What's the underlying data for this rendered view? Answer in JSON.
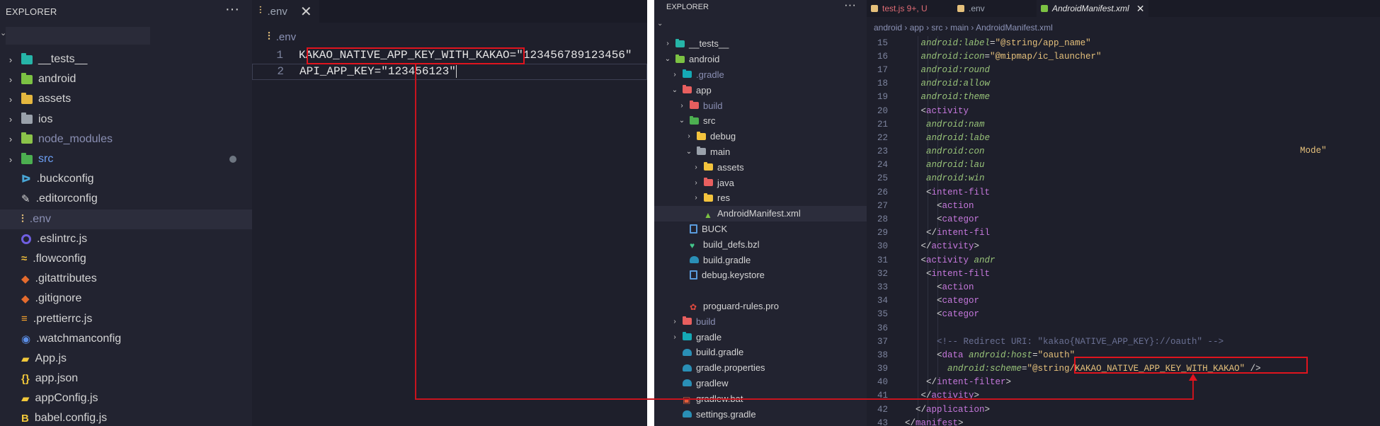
{
  "left": {
    "explorer": {
      "title": "EXPLORER",
      "more": "···",
      "items": [
        {
          "label": "__tests__",
          "icon": "folder-tests-icon",
          "chevron": ">"
        },
        {
          "label": "android",
          "icon": "folder-android-icon",
          "chevron": ">"
        },
        {
          "label": "assets",
          "icon": "folder-assets-icon",
          "chevron": ">"
        },
        {
          "label": "ios",
          "icon": "folder-ios-icon",
          "chevron": ">"
        },
        {
          "label": "node_modules",
          "icon": "folder-node-icon",
          "chevron": ">"
        },
        {
          "label": "src",
          "icon": "folder-src-icon",
          "chevron": ">"
        },
        {
          "label": ".buckconfig",
          "icon": "buck-icon"
        },
        {
          "label": ".editorconfig",
          "icon": "editorconfig-icon"
        },
        {
          "label": ".env",
          "icon": "env-icon"
        },
        {
          "label": ".eslintrc.js",
          "icon": "eslint-icon"
        },
        {
          "label": ".flowconfig",
          "icon": "flow-icon"
        },
        {
          "label": ".gitattributes",
          "icon": "git-icon"
        },
        {
          "label": ".gitignore",
          "icon": "git-icon"
        },
        {
          "label": ".prettierrc.js",
          "icon": "prettier-icon"
        },
        {
          "label": ".watchmanconfig",
          "icon": "watchman-icon"
        },
        {
          "label": "App.js",
          "icon": "js-icon"
        },
        {
          "label": "app.json",
          "icon": "json-icon"
        },
        {
          "label": "appConfig.js",
          "icon": "js-icon"
        },
        {
          "label": "babel.config.js",
          "icon": "babel-icon"
        }
      ]
    },
    "editor": {
      "tab_label": ".env",
      "close": "✕",
      "breadcrumb": ".env",
      "lines": [
        {
          "num": "1",
          "key": "KAKAO_NATIVE_APP_KEY_WITH_KAKAO",
          "eq": "=",
          "value": "\"123456789123456\""
        },
        {
          "num": "2",
          "key": "API_APP_KEY",
          "eq": "=",
          "value": "\"123456123\""
        }
      ]
    }
  },
  "right": {
    "explorer": {
      "title": "EXPLORER",
      "more": "···",
      "items": [
        {
          "label": "__tests__",
          "depth": 0,
          "chevron": ">",
          "icon": "folder-tests-icon"
        },
        {
          "label": "android",
          "depth": 0,
          "chevron": "v",
          "icon": "folder-android-icon"
        },
        {
          "label": ".gradle",
          "depth": 1,
          "chevron": ">",
          "icon": "folder-gradle-icon",
          "dim": true
        },
        {
          "label": "app",
          "depth": 1,
          "chevron": "v",
          "icon": "folder-red-icon"
        },
        {
          "label": "build",
          "depth": 2,
          "chevron": ">",
          "icon": "folder-red-icon",
          "dim": true
        },
        {
          "label": "src",
          "depth": 2,
          "chevron": "v",
          "icon": "folder-src-icon"
        },
        {
          "label": "debug",
          "depth": 3,
          "chevron": ">",
          "icon": "folder-assets-icon"
        },
        {
          "label": "main",
          "depth": 3,
          "chevron": "v",
          "icon": "folder-open-icon"
        },
        {
          "label": "assets",
          "depth": 4,
          "chevron": ">",
          "icon": "folder-assets-icon"
        },
        {
          "label": "java",
          "depth": 4,
          "chevron": ">",
          "icon": "folder-red-icon"
        },
        {
          "label": "res",
          "depth": 4,
          "chevron": ">",
          "icon": "folder-assets-icon"
        },
        {
          "label": "AndroidManifest.xml",
          "depth": 4,
          "icon": "android-icon",
          "selected": true
        },
        {
          "label": "BUCK",
          "depth": 2,
          "icon": "file-icon"
        },
        {
          "label": "build_defs.bzl",
          "depth": 2,
          "icon": "heart-icon"
        },
        {
          "label": "build.gradle",
          "depth": 2,
          "icon": "gradle-icon"
        },
        {
          "label": "debug.keystore",
          "depth": 2,
          "icon": "file-icon"
        },
        {
          "label": "",
          "depth": 2,
          "icon": ""
        },
        {
          "label": "proguard-rules.pro",
          "depth": 2,
          "icon": "proguard-icon"
        },
        {
          "label": "build",
          "depth": 1,
          "chevron": ">",
          "icon": "folder-red-icon",
          "dim": true
        },
        {
          "label": "gradle",
          "depth": 1,
          "chevron": ">",
          "icon": "folder-gradle-icon"
        },
        {
          "label": "build.gradle",
          "depth": 1,
          "icon": "gradle-icon"
        },
        {
          "label": "gradle.properties",
          "depth": 1,
          "icon": "gradle-icon"
        },
        {
          "label": "gradlew",
          "depth": 1,
          "icon": "gradle-icon"
        },
        {
          "label": "gradlew.bat",
          "depth": 1,
          "icon": "bat-icon"
        },
        {
          "label": "settings.gradle",
          "depth": 1,
          "icon": "gradle-icon"
        }
      ]
    },
    "tabs": [
      {
        "label": "test.js 9+, U",
        "icon_color": "#e5c07b"
      },
      {
        "label": ".env",
        "icon_color": "#e5c07b"
      },
      {
        "label": "AndroidManifest.xml",
        "icon_color": "#7cc243",
        "close": "✕"
      }
    ],
    "breadcrumb": [
      "android",
      "app",
      "src",
      "main",
      "AndroidManifest.xml"
    ],
    "code": [
      {
        "num": "15",
        "html": "<span class='t-attr'>android:label</span><span class='t-pun'>=</span><span class='t-str'>\"@string/app_name\"</span>",
        "indent": 3
      },
      {
        "num": "16",
        "html": "<span class='t-attr'>android:icon</span><span class='t-pun'>=</span><span class='t-str'>\"@mipmap/ic_launcher\"</span>",
        "indent": 3
      },
      {
        "num": "17",
        "html": "<span class='t-attr'>android:round</span>",
        "indent": 3
      },
      {
        "num": "18",
        "html": "<span class='t-attr'>android:allow</span>",
        "indent": 3
      },
      {
        "num": "19",
        "html": "<span class='t-attr'>android:theme</span>",
        "indent": 3
      },
      {
        "num": "20",
        "html": "<span class='t-pun'>&lt;</span><span class='t-tag'>activity</span>",
        "indent": 3
      },
      {
        "num": "21",
        "html": "<span class='t-attr'>android:nam</span>",
        "indent": 4
      },
      {
        "num": "22",
        "html": "<span class='t-attr'>android:labe</span>",
        "indent": 4
      },
      {
        "num": "23",
        "html": "<span class='t-attr'>android:con</span>",
        "indent": 4
      },
      {
        "num": "24",
        "html": "<span class='t-attr'>android:lau</span>",
        "indent": 4
      },
      {
        "num": "25",
        "html": "<span class='t-attr'>android:win</span>",
        "indent": 4
      },
      {
        "num": "26",
        "html": "<span class='t-pun'>&lt;</span><span class='t-tag'>intent-filt</span>",
        "indent": 4
      },
      {
        "num": "27",
        "html": "<span class='t-pun'>&lt;</span><span class='t-tag'>action</span>",
        "indent": 6
      },
      {
        "num": "28",
        "html": "<span class='t-pun'>&lt;</span><span class='t-tag'>categor</span>",
        "indent": 6
      },
      {
        "num": "29",
        "html": "<span class='t-pun'>&lt;/</span><span class='t-tag'>intent-fil</span>",
        "indent": 4
      },
      {
        "num": "30",
        "html": "<span class='t-pun'>&lt;/</span><span class='t-tag'>activity</span><span class='t-pun'>&gt;</span>",
        "indent": 3
      },
      {
        "num": "31",
        "html": "<span class='t-pun'>&lt;</span><span class='t-tag'>activity</span> <span class='t-attr'>andr</span>",
        "indent": 3
      },
      {
        "num": "32",
        "html": "<span class='t-pun'>&lt;</span><span class='t-tag'>intent-filt</span>",
        "indent": 4
      },
      {
        "num": "33",
        "html": "<span class='t-pun'>&lt;</span><span class='t-tag'>action</span>",
        "indent": 6
      },
      {
        "num": "34",
        "html": "<span class='t-pun'>&lt;</span><span class='t-tag'>categor</span>",
        "indent": 6
      },
      {
        "num": "35",
        "html": "<span class='t-pun'>&lt;</span><span class='t-tag'>categor</span>",
        "indent": 6
      },
      {
        "num": "36",
        "html": "",
        "indent": 0
      },
      {
        "num": "37",
        "html": "<span class='t-com'>&lt;!-- Redirect URI: \"kakao{NATIVE_APP_KEY}://oauth\" --&gt;</span>",
        "indent": 6
      },
      {
        "num": "38",
        "html": "<span class='t-pun'>&lt;</span><span class='t-tag'>data</span> <span class='t-attr'>android:host</span><span class='t-pun'>=</span><span class='t-str'>\"oauth\"</span>",
        "indent": 6
      },
      {
        "num": "39",
        "html": "<span class='t-attr'>android:scheme</span><span class='t-pun'>=</span><span class='t-str'>\"@string/KAKAO_NATIVE_APP_KEY_WITH_KAKAO\"</span> <span class='t-pun'>/&gt;</span>",
        "indent": 8
      },
      {
        "num": "40",
        "html": "<span class='t-pun'>&lt;/</span><span class='t-tag'>intent-filter</span><span class='t-pun'>&gt;</span>",
        "indent": 4
      },
      {
        "num": "41",
        "html": "<span class='t-pun'>&lt;/</span><span class='t-tag'>activity</span><span class='t-pun'>&gt;</span>",
        "indent": 3
      },
      {
        "num": "42",
        "html": "<span class='t-pun'>&lt;/</span><span class='t-tag'>application</span><span class='t-pun'>&gt;</span>",
        "indent": 2
      },
      {
        "num": "43",
        "html": "<span class='t-pun'>&lt;/</span><span class='t-tag'>manifest</span><span class='t-pun'>&gt;</span>",
        "indent": 0
      }
    ],
    "overflow_text": "Mode\""
  },
  "colors": {
    "annotation": "#e0141e",
    "tag": "#c678dd",
    "attribute": "#98c379",
    "string": "#e5c07b"
  }
}
